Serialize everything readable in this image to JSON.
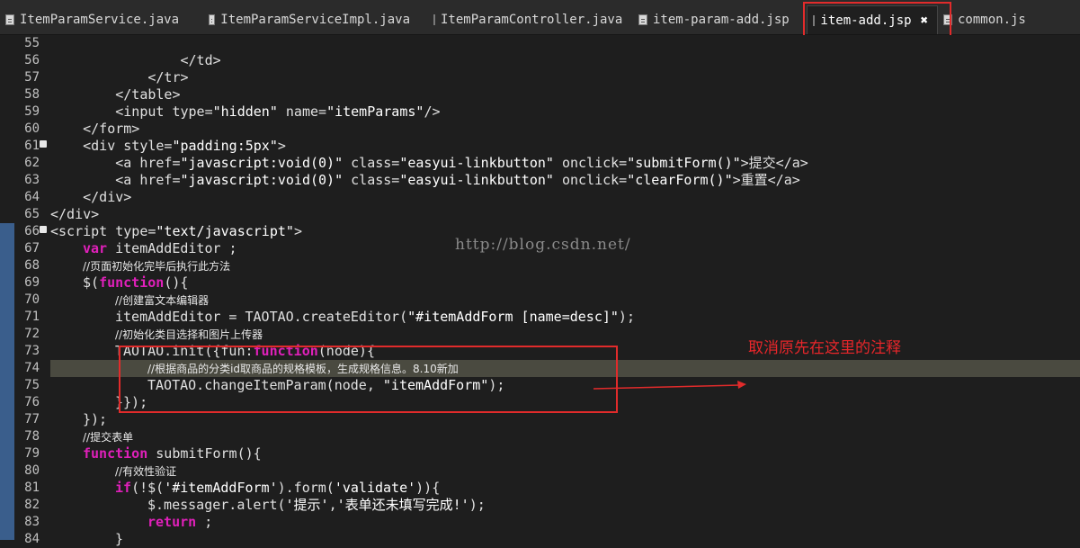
{
  "tabs": [
    {
      "label": "ItemParamService.java"
    },
    {
      "label": "ItemParamServiceImpl.java"
    },
    {
      "label": "ItemParamController.java"
    },
    {
      "label": "item-param-add.jsp"
    },
    {
      "label": "item-add.jsp"
    },
    {
      "label": "common.js"
    }
  ],
  "watermark": "http://blog.csdn.net/",
  "annotation": "取消原先在这里的注释",
  "lines": [
    {
      "n": "55"
    },
    {
      "n": "56",
      "t": "                </td>"
    },
    {
      "n": "57",
      "t": "            </tr>"
    },
    {
      "n": "58",
      "t": "        </table>"
    },
    {
      "n": "59",
      "a": "        <input type=",
      "b": "\"hidden\"",
      "c": " name=",
      "d": "\"itemParams\"",
      "e": "/>"
    },
    {
      "n": "60",
      "t": "    </form>"
    },
    {
      "n": "61",
      "a": "    <div style=",
      "b": "\"padding:5px\"",
      "c": ">"
    },
    {
      "n": "62",
      "a": "        <a href=",
      "b": "\"javascript:void(0)\"",
      "c": " class=",
      "d": "\"easyui-linkbutton\"",
      "e": " onclick=",
      "f": "\"submitForm()\"",
      "g": ">提交</a>"
    },
    {
      "n": "63",
      "a": "        <a href=",
      "b": "\"javascript:void(0)\"",
      "c": " class=",
      "d": "\"easyui-linkbutton\"",
      "e": " onclick=",
      "f": "\"clearForm()\"",
      "g": ">重置</a>"
    },
    {
      "n": "64",
      "t": "    </div>"
    },
    {
      "n": "65",
      "t": "</div>"
    },
    {
      "n": "66",
      "a": "<script type=",
      "b": "\"text/javascript\"",
      "c": ">"
    },
    {
      "n": "67",
      "k": "var",
      "t": " itemAddEditor ;"
    },
    {
      "n": "68",
      "cm": "//页面初始化完毕后执行此方法"
    },
    {
      "n": "69",
      "a": "$(",
      "k": "function",
      "t": "(){"
    },
    {
      "n": "70",
      "cm": "//创建富文本编辑器"
    },
    {
      "n": "71",
      "a": "itemAddEditor = TAOTAO.createEditor(",
      "b": "\"#itemAddForm [name=desc]\"",
      "c": ");"
    },
    {
      "n": "72",
      "cm": "//初始化类目选择和图片上传器"
    },
    {
      "n": "73",
      "a": "TAOTAO.init({fun:",
      "k": "function",
      "t": "(node){"
    },
    {
      "n": "74",
      "cm": "//根据商品的分类id取商品的规格模板，生成规格信息。8.10新加"
    },
    {
      "n": "75",
      "a": "TAOTAO.changeItemParam(node, ",
      "b": "\"itemAddForm\"",
      "c": ");"
    },
    {
      "n": "76",
      "t": "}});"
    },
    {
      "n": "77",
      "t": "});"
    },
    {
      "n": "78",
      "cm": "//提交表单"
    },
    {
      "n": "79",
      "k": "function",
      "t": " submitForm(){"
    },
    {
      "n": "80",
      "cm": "//有效性验证"
    },
    {
      "n": "81",
      "k": "if",
      "a": "(!$(",
      "b": "'#itemAddForm'",
      "c": ").form(",
      "d": "'validate'",
      "e": ")){"
    },
    {
      "n": "82",
      "a": "$.messager.alert(",
      "b": "'提示'",
      "c": ",",
      "d": "'表单还未填写完成!'",
      "e": ");"
    },
    {
      "n": "83",
      "k": "return",
      "t": " ;"
    },
    {
      "n": "84",
      "t": "}"
    }
  ]
}
